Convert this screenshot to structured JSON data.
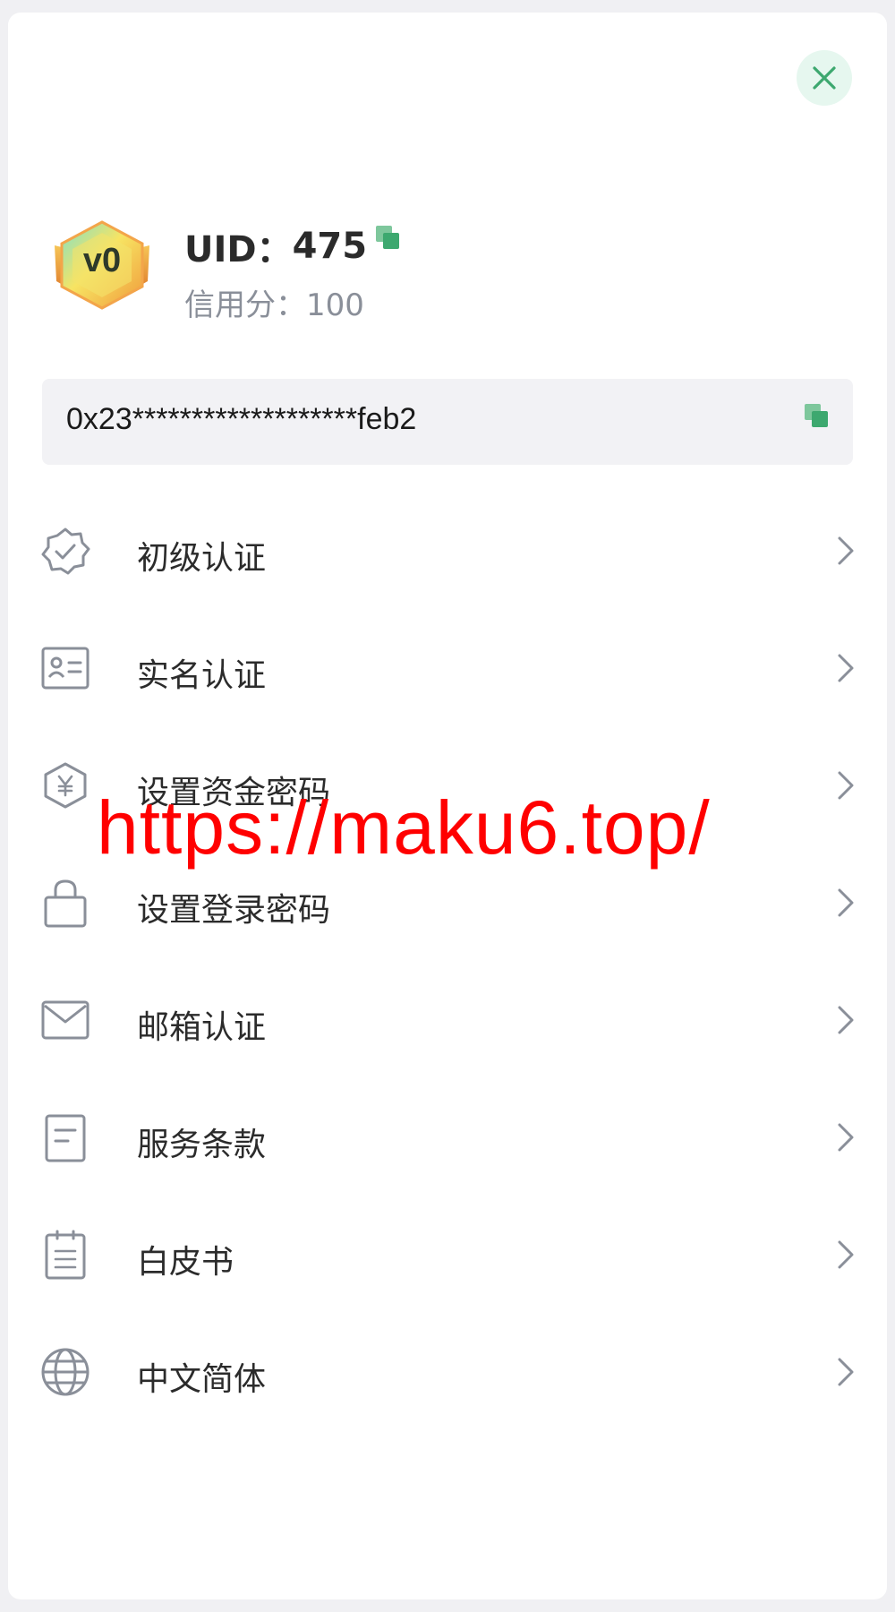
{
  "profile": {
    "level": "v0",
    "uid_label": "UID：",
    "uid_value": "475",
    "credit_label": "信用分：",
    "credit_value": "100"
  },
  "wallet": {
    "address": "0x23*******************feb2"
  },
  "menu": {
    "items": [
      {
        "label": "初级认证",
        "icon": "verified-badge-icon"
      },
      {
        "label": "实名认证",
        "icon": "id-card-icon"
      },
      {
        "label": "设置资金密码",
        "icon": "yuan-shield-icon"
      },
      {
        "label": "设置登录密码",
        "icon": "lock-icon"
      },
      {
        "label": "邮箱认证",
        "icon": "mail-icon"
      },
      {
        "label": "服务条款",
        "icon": "document-icon"
      },
      {
        "label": "白皮书",
        "icon": "clipboard-icon"
      },
      {
        "label": "中文简体",
        "icon": "globe-icon"
      }
    ]
  },
  "watermark": "https://maku6.top/",
  "colors": {
    "accent": "#3da86f",
    "icon_gray": "#8a8f99",
    "text": "#2b2b2b",
    "watermark": "#ff0000"
  }
}
